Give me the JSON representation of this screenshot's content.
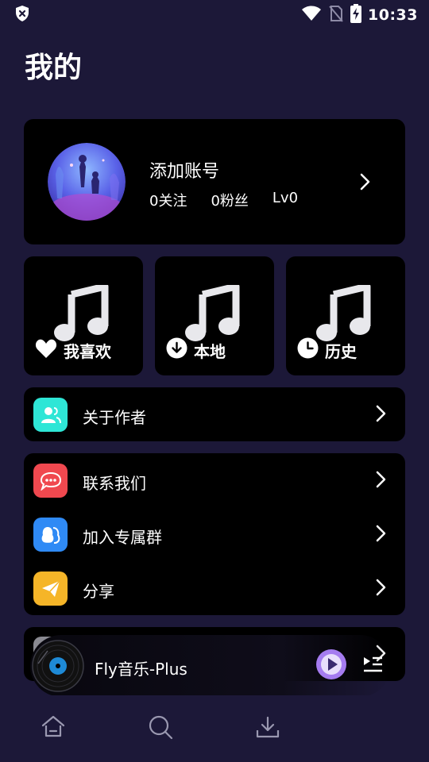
{
  "status_bar": {
    "time": "10:33",
    "icons": [
      "shield-x-icon",
      "wifi-icon",
      "no-sim-icon",
      "battery-charging-icon"
    ]
  },
  "page": {
    "title": "我的"
  },
  "account": {
    "name": "添加账号",
    "following": "0关注",
    "followers": "0粉丝",
    "level": "Lv0"
  },
  "tiles": [
    {
      "label": "我喜欢",
      "icon": "heart-icon"
    },
    {
      "label": "本地",
      "icon": "download-circle-icon"
    },
    {
      "label": "历史",
      "icon": "clock-icon"
    }
  ],
  "menu": {
    "about_author": "关于作者",
    "contact_us": "联系我们",
    "join_group": "加入专属群",
    "share": "分享"
  },
  "player": {
    "title": "Fly音乐-Plus"
  },
  "bottom_nav": [
    "home-icon",
    "search-icon",
    "download-icon"
  ],
  "colors": {
    "background": "#1c1838",
    "card": "#000000",
    "about_icon": "#2ee6d6",
    "contact_icon": "#f0484f",
    "group_icon": "#2f8af5",
    "share_icon": "#f5b528",
    "play_button": "#a57cf0"
  }
}
